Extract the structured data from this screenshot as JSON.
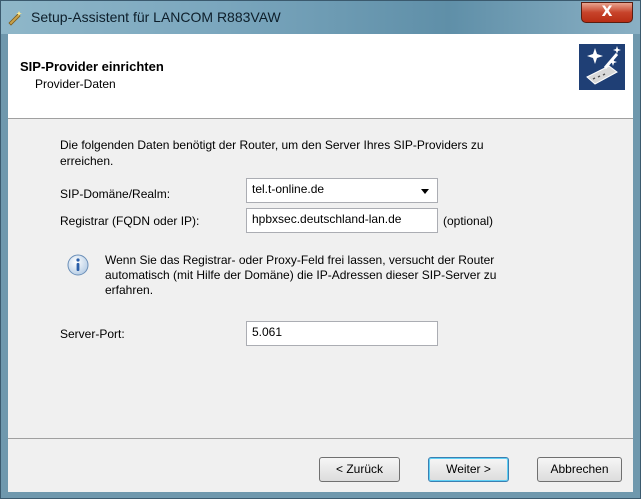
{
  "window": {
    "title": "Setup-Assistent für LANCOM R883VAW",
    "close_symbol": "X"
  },
  "header": {
    "title": "SIP-Provider einrichten",
    "subtitle": "Provider-Daten",
    "logo_icon": "wizard-sparkle-icon"
  },
  "content": {
    "description": "Die folgenden Daten benötigt der Router, um den Server Ihres SIP-Providers zu erreichen.",
    "sip_domain": {
      "label": "SIP-Domäne/Realm:",
      "value": "tel.t-online.de"
    },
    "registrar": {
      "label": "Registrar (FQDN oder IP):",
      "value": "hpbxsec.deutschland-lan.de",
      "hint": "(optional)"
    },
    "info": {
      "icon": "info-icon",
      "text": "Wenn Sie das Registrar- oder Proxy-Feld frei lassen, versucht der Router automatisch (mit Hilfe der Domäne) die IP-Adressen dieser SIP-Server zu erfahren."
    },
    "server_port": {
      "label": "Server-Port:",
      "value": "5.061"
    }
  },
  "buttons": {
    "back": "< Zurück",
    "next": "Weiter >",
    "cancel": "Abbrechen"
  }
}
